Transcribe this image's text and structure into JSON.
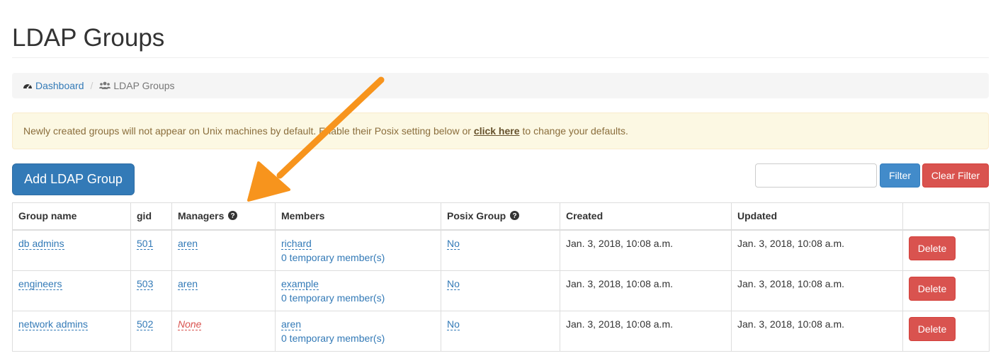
{
  "page": {
    "title": "LDAP Groups"
  },
  "breadcrumb": {
    "home_label": "Dashboard",
    "current_label": "LDAP Groups",
    "separator": "/"
  },
  "alert": {
    "text_before": "Newly created groups will not appear on Unix machines by default. Enable their Posix setting below or",
    "link_label": "click here",
    "text_after": "to change your defaults."
  },
  "toolbar": {
    "add_label": "Add LDAP Group",
    "filter_value": "",
    "filter_label": "Filter",
    "clear_label": "Clear Filter"
  },
  "table": {
    "headers": {
      "group_name": "Group name",
      "gid": "gid",
      "managers": "Managers",
      "members": "Members",
      "posix": "Posix Group",
      "created": "Created",
      "updated": "Updated",
      "actions": ""
    },
    "rows": [
      {
        "name": "db admins",
        "gid": "501",
        "manager": "aren",
        "member": "richard",
        "temp": "0 temporary member(s)",
        "posix": "No",
        "created": "Jan. 3, 2018, 10:08 a.m.",
        "updated": "Jan. 3, 2018, 10:08 a.m.",
        "delete": "Delete"
      },
      {
        "name": "engineers",
        "gid": "503",
        "manager": "aren",
        "member": "example",
        "temp": "0 temporary member(s)",
        "posix": "No",
        "created": "Jan. 3, 2018, 10:08 a.m.",
        "updated": "Jan. 3, 2018, 10:08 a.m.",
        "delete": "Delete"
      },
      {
        "name": "network admins",
        "gid": "502",
        "manager": "None",
        "member": "aren",
        "temp": "0 temporary member(s)",
        "posix": "No",
        "created": "Jan. 3, 2018, 10:08 a.m.",
        "updated": "Jan. 3, 2018, 10:08 a.m.",
        "delete": "Delete"
      }
    ]
  },
  "icons": {
    "home": "dashboard-icon",
    "current": "users-icon",
    "help": "question-circle-icon",
    "annotation": "arrow-annotation"
  },
  "colors": {
    "primary": "#337ab7",
    "danger": "#d9534f",
    "alert_bg": "#fcf8e3",
    "annotation": "#f7941d"
  }
}
